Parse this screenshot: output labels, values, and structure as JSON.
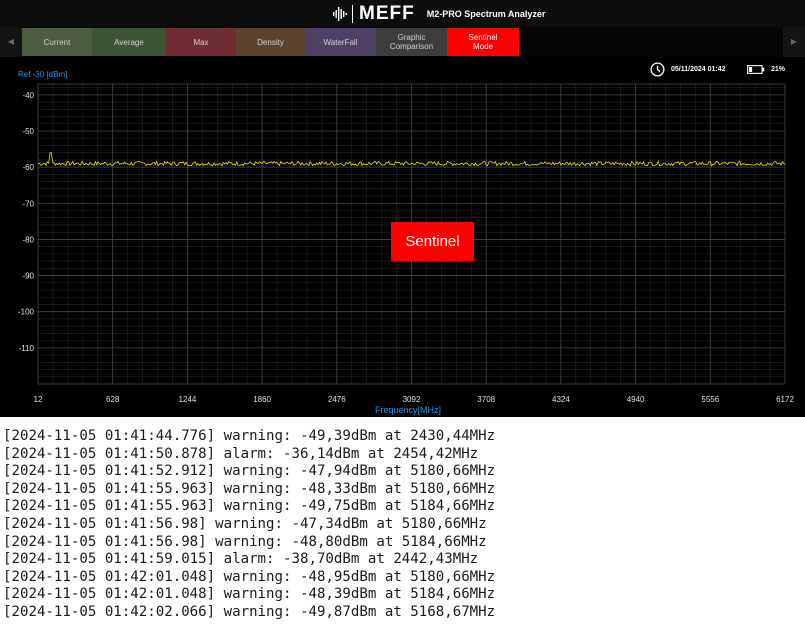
{
  "header": {
    "brand": "MEFF",
    "subtitle": "M2-PRO Spectrum Analyzer",
    "logo_icon": "audio-waveform-icon"
  },
  "tabs": [
    {
      "id": "current",
      "label": "Current"
    },
    {
      "id": "average",
      "label": "Average"
    },
    {
      "id": "max",
      "label": "Max"
    },
    {
      "id": "density",
      "label": "Density"
    },
    {
      "id": "waterfall",
      "label": "WaterFall"
    },
    {
      "id": "graphic",
      "label": "Graphic\nComparison"
    },
    {
      "id": "sentinel",
      "label": "Sentinel\nMode",
      "active": true
    }
  ],
  "status": {
    "datetime": "05/11/2024 01:42",
    "battery": "21%"
  },
  "chart": {
    "ref_label": "Ref -30 [dBm]",
    "xlabel": "Frequency[MHz]",
    "sentinel_badge": "Sentinel"
  },
  "chart_data": {
    "type": "line",
    "xlabel": "Frequency[MHz]",
    "ylabel": "Ref -30 [dBm]",
    "xlim": [
      12,
      6172
    ],
    "ylim": [
      -120,
      -37
    ],
    "xticks": [
      12,
      628,
      1244,
      1860,
      2476,
      3092,
      3708,
      4324,
      4940,
      5556,
      6172
    ],
    "yticks": [
      -40,
      -50,
      -60,
      -70,
      -80,
      -90,
      -100,
      -110
    ],
    "grid": true,
    "series": [
      {
        "baseline": -59,
        "noise": 0.6,
        "spike": {
          "x": 120,
          "y": -56
        },
        "color": "#e8e800"
      }
    ]
  },
  "log": [
    "[2024-11-05 01:41:44.776] warning: -49,39dBm at 2430,44MHz",
    "[2024-11-05 01:41:50.878] alarm: -36,14dBm at 2454,42MHz",
    "[2024-11-05 01:41:52.912] warning: -47,94dBm at 5180,66MHz",
    "[2024-11-05 01:41:55.963] warning: -48,33dBm at 5180,66MHz",
    "[2024-11-05 01:41:55.963] warning: -49,75dBm at 5184,66MHz",
    "[2024-11-05 01:41:56.98] warning: -47,34dBm at 5180,66MHz",
    "[2024-11-05 01:41:56.98] warning: -48,80dBm at 5184,66MHz",
    "[2024-11-05 01:41:59.015] alarm: -38,70dBm at 2442,43MHz",
    "[2024-11-05 01:42:01.048] warning: -48,95dBm at 5180,66MHz",
    "[2024-11-05 01:42:01.048] warning: -48,39dBm at 5184,66MHz",
    "[2024-11-05 01:42:02.066] warning: -49,87dBm at 5168,67MHz"
  ]
}
